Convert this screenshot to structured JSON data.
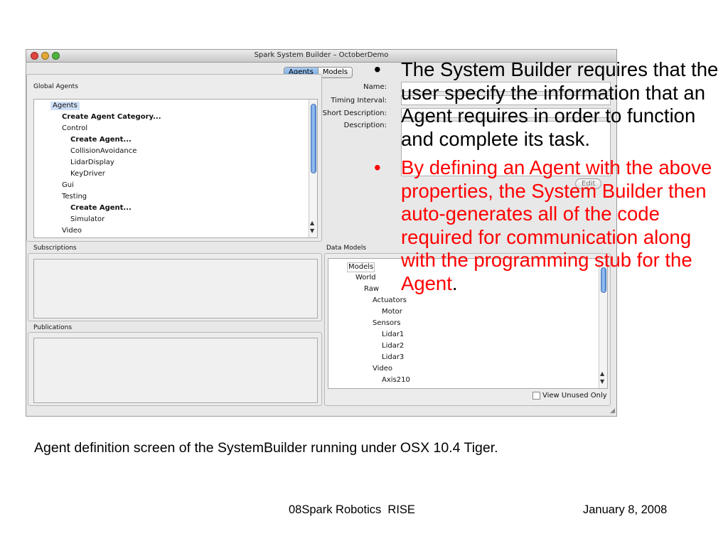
{
  "window": {
    "title": "Spark System Builder – OctoberDemo",
    "tabs": [
      "Agents",
      "Models"
    ],
    "active_tab": "Agents"
  },
  "global_agents": {
    "label": "Global Agents",
    "items": [
      {
        "text": "Agents",
        "bold": false,
        "selected": true
      },
      {
        "text": "Create Agent Category...",
        "bold": true
      },
      {
        "text": "Control",
        "bold": false
      },
      {
        "text": "Create Agent...",
        "bold": true
      },
      {
        "text": "CollisionAvoidance",
        "bold": false
      },
      {
        "text": "LidarDisplay",
        "bold": false
      },
      {
        "text": "KeyDriver",
        "bold": false
      },
      {
        "text": "Gui",
        "bold": false
      },
      {
        "text": "Testing",
        "bold": false
      },
      {
        "text": "Create Agent...",
        "bold": true
      },
      {
        "text": "Simulator",
        "bold": false
      },
      {
        "text": "Video",
        "bold": false
      }
    ]
  },
  "details": {
    "name_label": "Name:",
    "timing_label": "Timing Interval:",
    "short_desc_label": "Short Description:",
    "desc_label": "Description:",
    "edit_button": "Edit"
  },
  "subscriptions": {
    "label": "Subscriptions"
  },
  "publications": {
    "label": "Publications"
  },
  "data_models": {
    "label": "Data Models",
    "items": [
      "Models",
      "World",
      "Raw",
      "Actuators",
      "Motor",
      "Sensors",
      "Lidar1",
      "Lidar2",
      "Lidar3",
      "Video",
      "Axis210"
    ],
    "view_unused_label": "View Unused Only"
  },
  "slide": {
    "bullet1": "The System Builder requires that the user specify the information that an Agent requires in order to function and complete its task.",
    "bullet2_red": "By defining an Agent with the above properties, the System Builder then auto-generates all of the code required for communication along with the programming stub for the Agent",
    "bullet2_tail": ".",
    "caption": "Agent definition screen of the SystemBuilder running under OSX 10.4 Tiger.",
    "footer_center": "08Spark Robotics  RISE",
    "footer_right": "January 8, 2008"
  },
  "colors": {
    "highlight_red": "#ff0000",
    "selection_blue": "#cfe0f7"
  }
}
